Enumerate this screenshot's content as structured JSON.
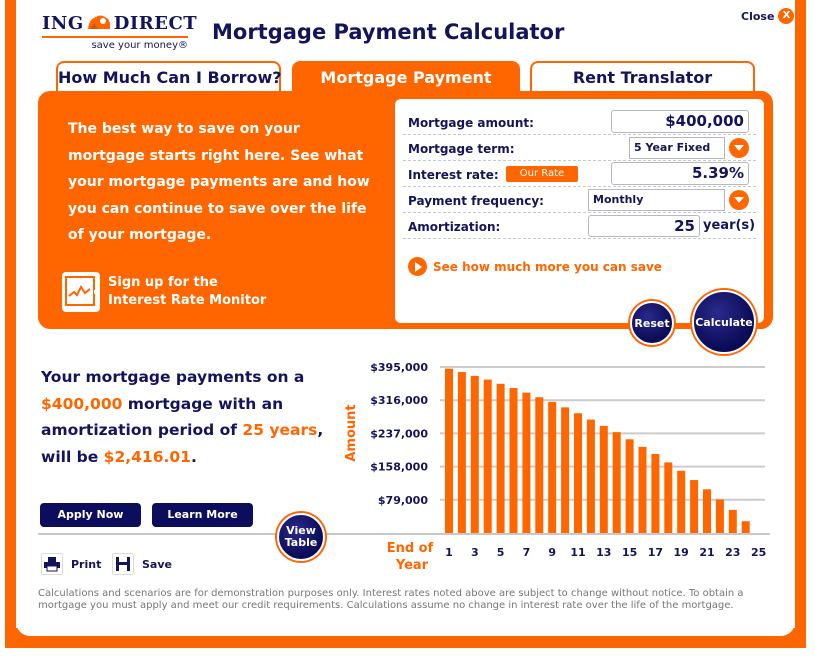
{
  "header": {
    "logo_text_left": "ING",
    "logo_text_right": "DIRECT",
    "logo_tagline": "save your money®",
    "title": "Mortgage Payment Calculator",
    "close_label": "Close",
    "close_icon": "X"
  },
  "tabs": [
    {
      "label": "How Much Can I Borrow?",
      "active": false
    },
    {
      "label": "Mortgage Payment",
      "active": true
    },
    {
      "label": "Rent Translator",
      "active": false
    }
  ],
  "intro": {
    "text": "The best way to save on your mortgage starts right here. See what your mortgage payments are and how you can continue to save over the life of your mortgage.",
    "monitor_line1": "Sign up for the",
    "monitor_line2": "Interest Rate Monitor"
  },
  "form": {
    "mortgage_amount_label": "Mortgage amount:",
    "mortgage_amount_value": "$400,000",
    "mortgage_term_label": "Mortgage term:",
    "mortgage_term_value": "5 Year Fixed",
    "interest_rate_label": "Interest rate:",
    "our_rate_label": "Our Rate",
    "interest_rate_value": "5.39",
    "interest_rate_unit": "%",
    "payment_frequency_label": "Payment frequency:",
    "payment_frequency_value": "Monthly",
    "amortization_label": "Amortization:",
    "amortization_value": "25",
    "amortization_unit": "year(s)",
    "save_more_link": "See how much more you can save",
    "reset_label": "Reset",
    "calculate_label": "Calculate"
  },
  "summary": {
    "line1": "Your mortgage payments on a",
    "amount": "$400,000",
    "line2": " mortgage with an amortization period of ",
    "period": "25 years",
    "line3": ", will be ",
    "payment": "$2,416.01",
    "end": "."
  },
  "actions": {
    "apply_now": "Apply Now",
    "learn_more": "Learn More",
    "view_table": "View Table",
    "print": "Print",
    "save": "Save"
  },
  "disclaimer": "Calculations and scenarios are for demonstration purposes only. Interest rates noted above are subject to change without notice. To obtain a mortgage you must apply and meet our credit requirements. Calculations assume no change in interest rate over the life of the mortgage.",
  "colors": {
    "accent": "#ff6600",
    "navy": "#14145a",
    "button_navy": "#0d0d5e"
  },
  "chart_data": {
    "type": "bar",
    "title": "",
    "xlabel": "End of Year",
    "ylabel": "Amount",
    "ylim": [
      0,
      395000
    ],
    "yticks": [
      79000,
      158000,
      237000,
      316000,
      395000
    ],
    "ytick_labels": [
      "$79,000",
      "$158,000",
      "$237,000",
      "$316,000",
      "$395,000"
    ],
    "xtick_labels": [
      "1",
      "3",
      "5",
      "7",
      "9",
      "11",
      "13",
      "15",
      "17",
      "19",
      "21",
      "23",
      "25"
    ],
    "categories": [
      "1",
      "2",
      "3",
      "4",
      "5",
      "6",
      "7",
      "8",
      "9",
      "10",
      "11",
      "12",
      "13",
      "14",
      "15",
      "16",
      "17",
      "18",
      "19",
      "20",
      "21",
      "22",
      "23",
      "24",
      "25"
    ],
    "values": [
      391000,
      383000,
      374000,
      365000,
      355000,
      345000,
      334000,
      323000,
      312000,
      299000,
      285000,
      270000,
      255000,
      240000,
      223000,
      205000,
      188000,
      168000,
      148000,
      126000,
      104000,
      80000,
      55000,
      28000,
      0
    ],
    "grid": true,
    "bar_color": "#ff6600"
  }
}
